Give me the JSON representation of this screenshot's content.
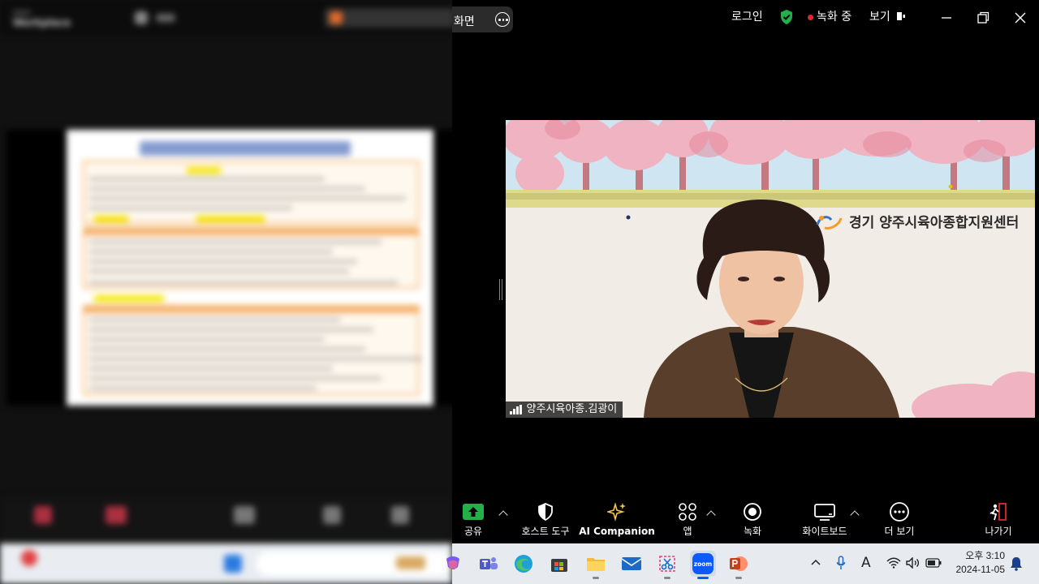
{
  "left_panel": {
    "brand_line1": "zoom",
    "brand_line2": "Workplace"
  },
  "share_pill": {
    "label": "화면"
  },
  "topbar": {
    "login": "로그인",
    "recording": "녹화 중",
    "view": "보기"
  },
  "video": {
    "participant_name": "양주시육아종.김광이",
    "banner_text": "경기 양주시육아종합지원센터"
  },
  "toolbar": {
    "share": "공유",
    "host_tools": "호스트 도구",
    "ai_companion": "AI Companion",
    "apps": "앱",
    "record": "녹화",
    "whiteboard": "화이트보드",
    "more": "더 보기",
    "leave": "나가기"
  },
  "taskbar": {
    "time": "오후 3:10",
    "date": "2024-11-05",
    "ime": "A"
  },
  "colors": {
    "share_green": "#23b04b",
    "shield_green": "#23b04b",
    "record_red": "#e0262e",
    "leave_red": "#e0262e",
    "ai_gold": "#f2c94c"
  }
}
